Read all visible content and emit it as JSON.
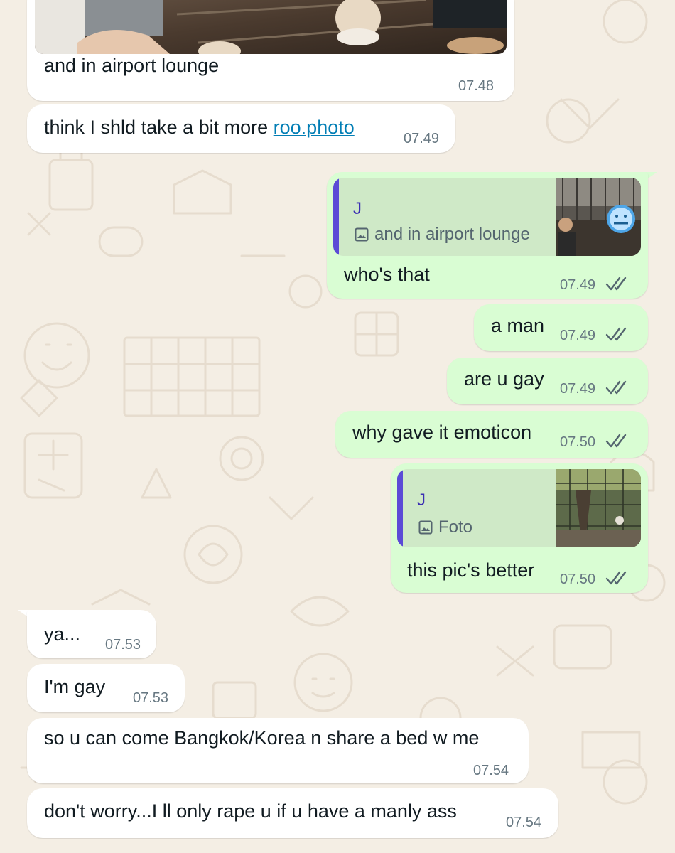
{
  "messages": [
    {
      "id": "m1",
      "dir": "in",
      "text": "and in airport lounge",
      "time": "07.48"
    },
    {
      "id": "m2",
      "dir": "in",
      "text_before": "think I shld take a bit more ",
      "link": "roo.photo",
      "time": "07.49"
    },
    {
      "id": "m3",
      "dir": "out",
      "quote": {
        "name": "J",
        "sub": "and in airport lounge"
      },
      "text": "who's that",
      "time": "07.49"
    },
    {
      "id": "m4",
      "dir": "out",
      "text": "a man",
      "time": "07.49"
    },
    {
      "id": "m5",
      "dir": "out",
      "text": "are u gay",
      "time": "07.49"
    },
    {
      "id": "m6",
      "dir": "out",
      "text": "why gave it emoticon",
      "time": "07.50"
    },
    {
      "id": "m7",
      "dir": "out",
      "quote": {
        "name": "J",
        "sub": "Foto"
      },
      "text": "this pic's better",
      "time": "07.50"
    },
    {
      "id": "m8",
      "dir": "in",
      "text": "ya...",
      "time": "07.53"
    },
    {
      "id": "m9",
      "dir": "in",
      "text": "I'm gay",
      "time": "07.53"
    },
    {
      "id": "m10",
      "dir": "in",
      "text": "so u can come Bangkok/Korea n share a bed w me",
      "time": "07.54"
    },
    {
      "id": "m11",
      "dir": "in",
      "text": "don't worry...I ll only rape u if u have a manly ass",
      "time": "07.54"
    }
  ],
  "colors": {
    "wallpaper": "#f4eee4",
    "incoming_bubble": "#ffffff",
    "outgoing_bubble": "#d9fdd3",
    "quote_bar": "#5b4bd6",
    "link": "#027eb5",
    "read_ticks": "#54656f"
  },
  "icons": {
    "read_receipt": "double-check-icon",
    "quoted_image": "image-icon"
  }
}
